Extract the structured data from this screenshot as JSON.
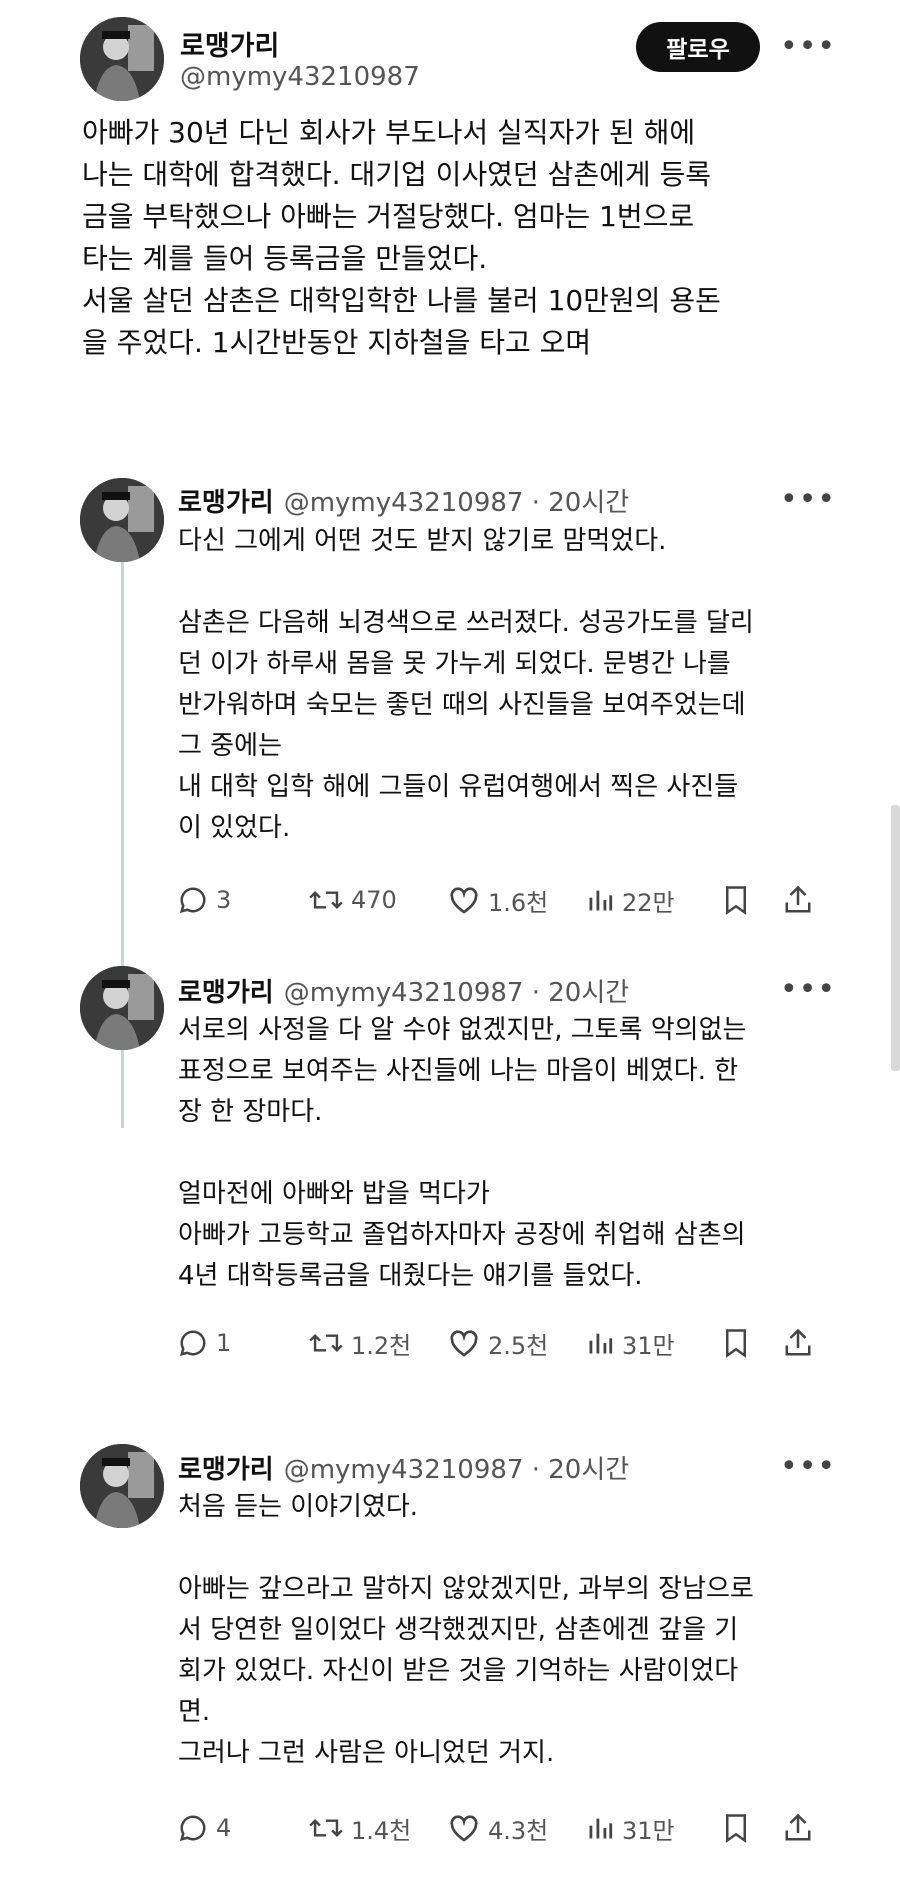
{
  "main_post": {
    "display_name": "로맹가리",
    "handle": "@mymy43210987",
    "follow_label": "팔로우",
    "more_label": "•••",
    "text": "아빠가 30년 다닌 회사가 부도나서 실직자가 된 해에\n나는 대학에 합격했다. 대기업 이사였던 삼촌에게 등록\n금을 부탁했으나 아빠는 거절당했다. 엄마는 1번으로\n타는 계를 들어 등록금을 만들었다.\n서울 살던 삼촌은 대학입학한 나를 불러 10만원의 용돈\n을 주었다. 1시간반동안 지하철을 타고 오며"
  },
  "replies": [
    {
      "display_name": "로맹가리",
      "handle": "@mymy43210987",
      "separator": "·",
      "time": "20시간",
      "more_label": "•••",
      "text": "다신 그에게 어떤 것도 받지 않기로 맘먹었다.\n\n삼촌은 다음해 뇌경색으로 쓰러졌다. 성공가도를 달리\n던 이가 하루새 몸을 못 가누게 되었다. 문병간 나를\n반가워하며 숙모는 좋던 때의 사진들을 보여주었는데\n그 중에는\n내 대학 입학 해에 그들이 유럽여행에서 찍은 사진들\n이 있었다.",
      "replies": "3",
      "reposts": "470",
      "likes": "1.6천",
      "views": "22만"
    },
    {
      "display_name": "로맹가리",
      "handle": "@mymy43210987",
      "separator": "·",
      "time": "20시간",
      "more_label": "•••",
      "text": "서로의 사정을 다 알 수야 없겠지만, 그토록 악의없는\n표정으로 보여주는 사진들에 나는 마음이 베였다. 한\n장 한 장마다.\n\n얼마전에 아빠와 밥을 먹다가\n아빠가 고등학교 졸업하자마자 공장에 취업해 삼촌의\n4년 대학등록금을 대줬다는 얘기를 들었다.",
      "replies": "1",
      "reposts": "1.2천",
      "likes": "2.5천",
      "views": "31만"
    },
    {
      "display_name": "로맹가리",
      "handle": "@mymy43210987",
      "separator": "·",
      "time": "20시간",
      "more_label": "•••",
      "text": "처음 듣는 이야기였다.\n\n아빠는 갚으라고 말하지 않았겠지만, 과부의 장남으로\n서 당연한 일이었다 생각했겠지만, 삼촌에겐 갚을 기\n회가 있었다. 자신이 받은 것을 기억하는 사람이었다\n면.\n그러나 그런 사람은 아니었던 거지.",
      "replies": "4",
      "reposts": "1.4천",
      "likes": "4.3천",
      "views": "31만"
    }
  ],
  "icons": {
    "reply": "reply-icon",
    "repost": "repost-icon",
    "like": "heart-icon",
    "views": "views-icon",
    "bookmark": "bookmark-icon",
    "share": "share-icon"
  },
  "colors": {
    "text": "#111111",
    "secondary": "#555555",
    "follow_bg": "#111111",
    "thread_line": "#cfd4d9"
  }
}
